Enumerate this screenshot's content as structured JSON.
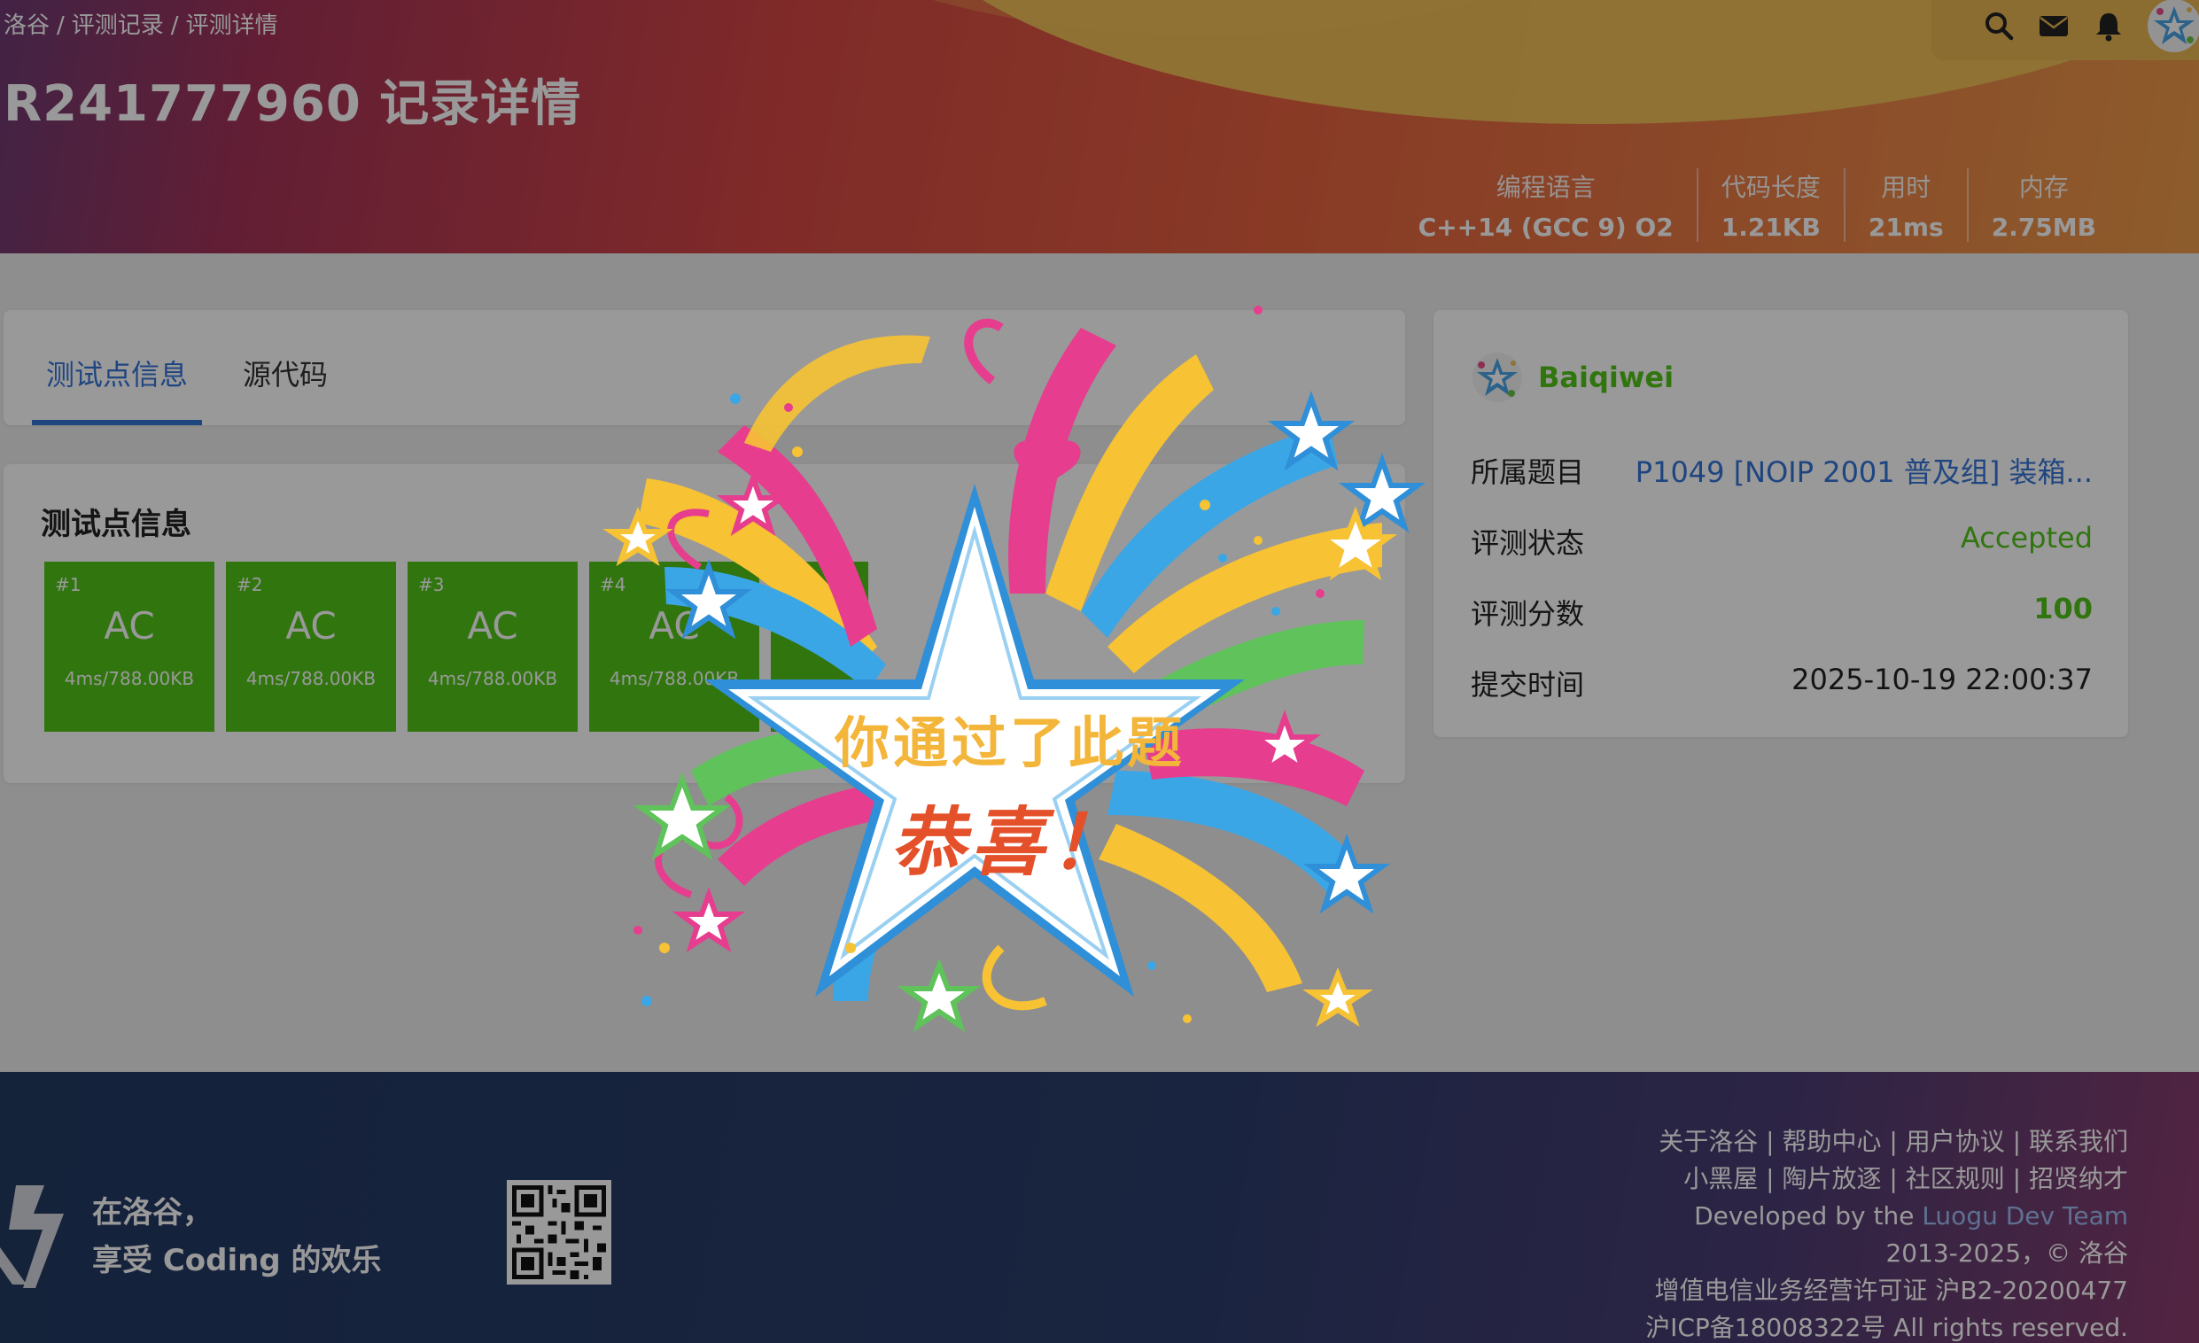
{
  "breadcrumb": [
    "洛谷",
    "评测记录",
    "评测详情"
  ],
  "page_title": "R241777960 记录详情",
  "topnav": {
    "icons": [
      "search-icon",
      "mail-icon",
      "bell-icon",
      "avatar"
    ]
  },
  "stats": [
    {
      "label": "编程语言",
      "value": "C++14 (GCC 9) O2"
    },
    {
      "label": "代码长度",
      "value": "1.21KB"
    },
    {
      "label": "用时",
      "value": "21ms"
    },
    {
      "label": "内存",
      "value": "2.75MB"
    }
  ],
  "tabs": [
    {
      "label": "测试点信息",
      "active": true
    },
    {
      "label": "源代码",
      "active": false
    }
  ],
  "testcases_title": "测试点信息",
  "testcases": [
    {
      "num": "#1",
      "status": "AC",
      "info": "4ms/788.00KB"
    },
    {
      "num": "#2",
      "status": "AC",
      "info": "4ms/788.00KB"
    },
    {
      "num": "#3",
      "status": "AC",
      "info": "4ms/788.00KB"
    },
    {
      "num": "#4",
      "status": "AC",
      "info": "4ms/788.00KB"
    }
  ],
  "info": {
    "username": "Baiqiwei",
    "rows": [
      {
        "label": "所属题目",
        "value": "P1049 [NOIP 2001 普及组] 装箱..."
      },
      {
        "label": "评测状态",
        "value": "Accepted"
      },
      {
        "label": "评测分数",
        "value": "100"
      },
      {
        "label": "提交时间",
        "value": "2025-10-19 22:00:37"
      }
    ]
  },
  "footer": {
    "slogan_line1": "在洛谷，",
    "slogan_line2": "享受 Coding 的欢乐",
    "links_row1": [
      "关于洛谷",
      "帮助中心",
      "用户协议",
      "联系我们"
    ],
    "links_row2": [
      "小黑屋",
      "陶片放逐",
      "社区规则",
      "招贤纳才"
    ],
    "developed_prefix": "Developed by the ",
    "team": "Luogu Dev Team",
    "copyright": "2013-2025，© 洛谷",
    "license": "增值电信业务经营许可证 沪B2-20200477",
    "icp": "沪ICP备18008322号 All rights reserved."
  },
  "overlay": {
    "line1": "你通过了此题",
    "line2": "恭喜！"
  },
  "colors": {
    "accent": "#3474d8",
    "ac_green": "#52c41a",
    "footer_bg": "#2b3c6b"
  }
}
